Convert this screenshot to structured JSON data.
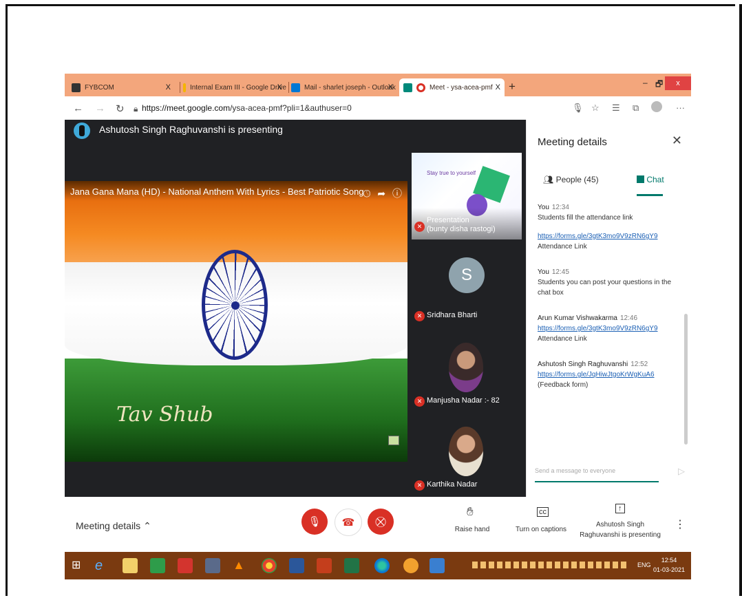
{
  "tabs": [
    {
      "label": "FYBCOM",
      "icon": "app-icon",
      "color": "#333333"
    },
    {
      "label": "Internal Exam III - Google Drive",
      "icon": "drive-icon",
      "color": "#f4b400"
    },
    {
      "label": "Mail - sharlet joseph - Outlook",
      "icon": "outlook-icon",
      "color": "#0078d4"
    },
    {
      "label": "Meet - ysa-acea-pmf",
      "icon": "meet-icon",
      "color": "#00897b"
    }
  ],
  "tab_close": "X",
  "new_tab": "+",
  "window": {
    "minimize": "–",
    "restore": "🗗",
    "close": "x"
  },
  "address": {
    "url_host": "https://meet.google.com",
    "url_path": "/ysa-acea-pmf?pli=1&authuser=0"
  },
  "presenter_text": "Ashutosh Singh Raghuvanshi is presenting",
  "video": {
    "title": "Jana Gana Mana (HD) - National Anthem With Lyrics - Best Patriotic Song",
    "overlay_text": "Tav Shub"
  },
  "tiles": [
    {
      "name": "Presentation\n(bunty disha rastogi)",
      "slide_text": "Stay true to yourself"
    },
    {
      "name": "Sridhara Bharti",
      "initial": "S"
    },
    {
      "name": "Manjusha Nadar :- 82"
    },
    {
      "name": "Karthika Nadar"
    }
  ],
  "panel": {
    "title": "Meeting details",
    "people_tab": "People (45)",
    "chat_tab": "Chat",
    "messages": [
      {
        "sender": "You",
        "time": "12:34",
        "lines": [
          "Students fill the attendance link"
        ],
        "link": "https://forms.gle/3gtK3mo9V9zRN6gY9",
        "after": "Attendance Link"
      },
      {
        "sender": "You",
        "time": "12:45",
        "lines": [
          "Students you can post your questions in the chat box"
        ],
        "link": "",
        "after": ""
      },
      {
        "sender": "Arun Kumar Vishwakarma",
        "time": "12:46",
        "lines": [],
        "link": "https://forms.gle/3gtK3mo9V9zRN6gY9",
        "after": "Attendance Link"
      },
      {
        "sender": "Ashutosh Singh Raghuvanshi",
        "time": "12:52",
        "lines": [],
        "link": "https://forms.gle/JqHiwJtgoKrWgKuA6",
        "after": "(Feedback form)"
      }
    ],
    "send_placeholder": "Send a message to everyone"
  },
  "bottom": {
    "meeting_details": "Meeting details",
    "raise_hand": "Raise hand",
    "captions": "Turn on captions",
    "presenting": "Ashutosh Singh Raghuvanshi is presenting"
  },
  "taskbar": {
    "lang": "ENG",
    "time": "12:54",
    "date": "01-03-2021"
  }
}
